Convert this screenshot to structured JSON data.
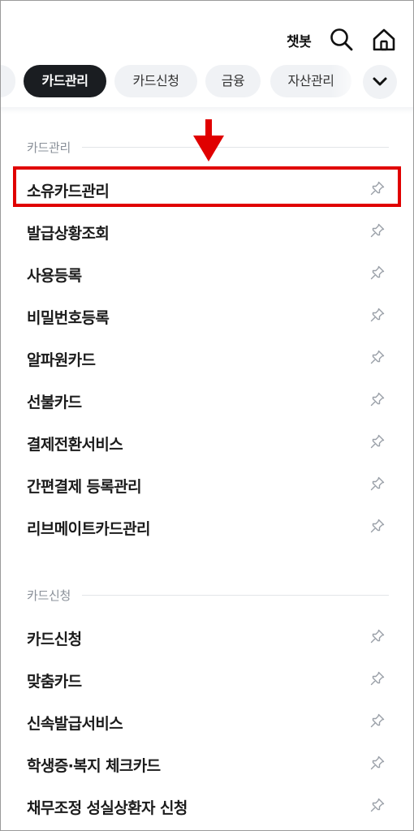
{
  "header": {
    "chatbot_label": "챗봇",
    "search_icon": "search-icon",
    "home_icon": "home-icon"
  },
  "tabs": {
    "items": [
      {
        "label": "카드관리",
        "active": true
      },
      {
        "label": "카드신청",
        "active": false
      },
      {
        "label": "금융",
        "active": false
      },
      {
        "label": "자산관리",
        "active": false
      }
    ],
    "expand_icon": "chevron-down-icon"
  },
  "sections": [
    {
      "title": "카드관리",
      "items": [
        {
          "label": "소유카드관리"
        },
        {
          "label": "발급상황조회"
        },
        {
          "label": "사용등록"
        },
        {
          "label": "비밀번호등록"
        },
        {
          "label": "알파원카드"
        },
        {
          "label": "선불카드"
        },
        {
          "label": "결제전환서비스"
        },
        {
          "label": "간편결제 등록관리"
        },
        {
          "label": "리브메이트카드관리"
        }
      ]
    },
    {
      "title": "카드신청",
      "items": [
        {
          "label": "카드신청"
        },
        {
          "label": "맞춤카드"
        },
        {
          "label": "신속발급서비스"
        },
        {
          "label": "학생증·복지 체크카드"
        },
        {
          "label": "채무조정 성실상환자 신청"
        }
      ]
    }
  ],
  "annotation": {
    "highlight_color": "#e00000",
    "highlighted_item": "소유카드관리"
  },
  "colors": {
    "active_tab_bg": "#1a1d21",
    "tab_bg": "#f0f2f5",
    "section_title": "#8a9099"
  }
}
